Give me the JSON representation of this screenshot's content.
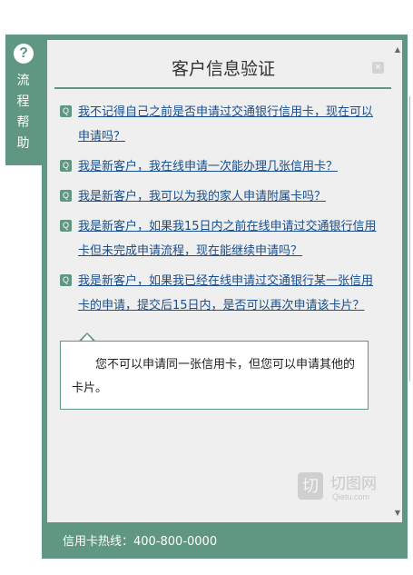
{
  "help_tab": {
    "icon": "question-circle-icon",
    "label": [
      "流",
      "程",
      "帮",
      "助"
    ]
  },
  "panel": {
    "title": "客户信息验证",
    "close_icon": "close-icon",
    "faq": [
      "我不记得自己之前是否申请过交通银行信用卡，现在可以申请吗？",
      "我是新客户，我在线申请一次能办理几张信用卡？",
      "我是新客户，我可以为我的家人申请附属卡吗？",
      "我是新客户，如果我15日内之前在线申请过交通银行信用卡但未完成申请流程，现在能继续申请吗？",
      "我是新客户，如果我已经在线申请过交通银行某一张信用卡的申请，提交后15日内，是否可以再次申请该卡片？"
    ],
    "answer": "您不可以申请同一张信用卡，但您可以申请其他的卡片。",
    "watermark": {
      "cn": "切图网",
      "en": "Qietu.com",
      "logo": "切"
    }
  },
  "footer": {
    "hotline": "信用卡热线：400-800-0000"
  },
  "colors": {
    "accent": "#5f9782",
    "link": "#1a4e8c"
  }
}
